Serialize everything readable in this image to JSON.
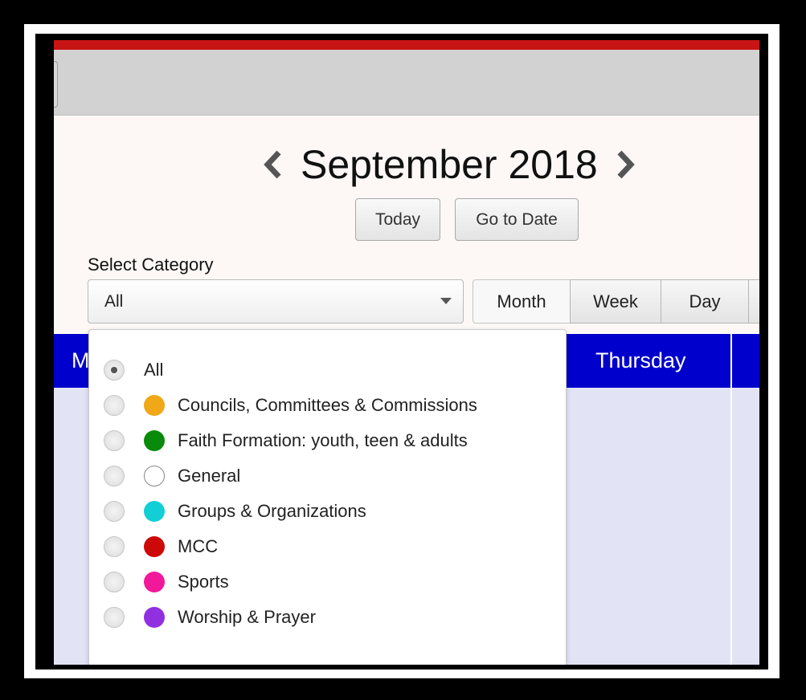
{
  "calendar": {
    "month_title": "September 2018",
    "today_label": "Today",
    "go_to_date_label": "Go to Date",
    "select_category_label": "Select Category",
    "selected_category": "All",
    "views": {
      "month": "Month",
      "week": "Week",
      "day": "Day"
    },
    "weekday_partial": "M",
    "weekday_thursday": "Thursday"
  },
  "categories": [
    {
      "label": "All",
      "color": null,
      "checked": true
    },
    {
      "label": "Councils, Committees & Commissions",
      "color": "#f0a818"
    },
    {
      "label": "Faith Formation: youth, teen & adults",
      "color": "#0a8a0a"
    },
    {
      "label": "General",
      "color": "hollow"
    },
    {
      "label": "Groups & Organizations",
      "color": "#12cfd6"
    },
    {
      "label": "MCC",
      "color": "#cc0808"
    },
    {
      "label": "Sports",
      "color": "#f2189a"
    },
    {
      "label": "Worship & Prayer",
      "color": "#9130e0"
    }
  ],
  "colors": {
    "header_red": "#c81414",
    "weekday_bar_blue": "#0000cc",
    "grid_background": "#e3e3f6"
  },
  "icons": {
    "prev": "chevron-left-icon",
    "next": "chevron-right-icon",
    "select_caret": "caret-down-icon"
  }
}
